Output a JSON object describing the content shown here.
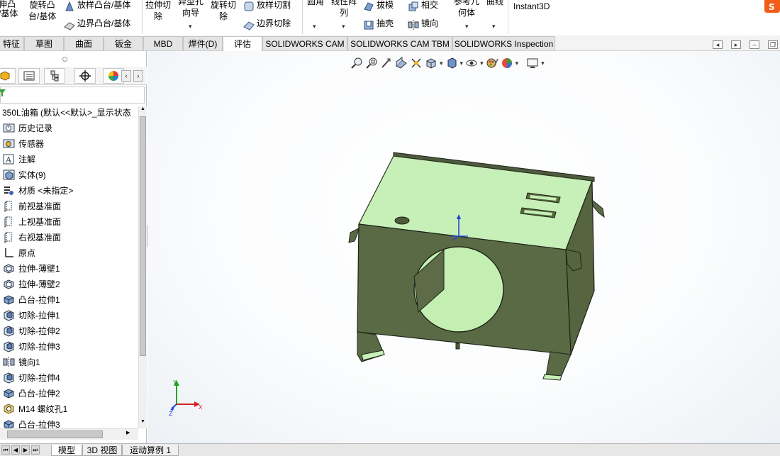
{
  "ribbon": {
    "extrude_boss": "伸凸台/基体",
    "extrude_boss_l1": "伸凸",
    "extrude_boss_l2": "/基体",
    "revolve_boss_l1": "旋转凸",
    "revolve_boss_l2": "台/基体",
    "swept_boss": "放样凸台/基体",
    "boundary_boss": "边界凸台/基体",
    "extruded_cut_l1": "拉伸切",
    "extruded_cut_l2": "除",
    "hole_wizard_l1": "异型孔",
    "hole_wizard_l2": "向导",
    "revolve_cut_l1": "旋转切",
    "revolve_cut_l2": "除",
    "lofted_cut": "放样切割",
    "boundary_cut": "边界切除",
    "fillet": "圆角",
    "linear_pattern_l1": "线性阵",
    "linear_pattern_l2": "列",
    "draft": "拔模",
    "intersect": "相交",
    "shell": "抽壳",
    "mirror": "镜向",
    "ref_geometry_l1": "参考几",
    "ref_geometry_l2": "何体",
    "curves": "曲线",
    "instant3d": "Instant3D"
  },
  "tabs": [
    "特征",
    "草图",
    "曲面",
    "钣金",
    "MBD",
    "焊件(D)",
    "评估",
    "SOLIDWORKS CAM",
    "SOLIDWORKS CAM TBM",
    "SOLIDWORKS Inspection"
  ],
  "tabs_active": "评估",
  "tree": {
    "root": "350L油箱  (默认<<默认>_显示状态",
    "items": [
      {
        "icon": "history-icon",
        "label": "历史记录"
      },
      {
        "icon": "sensor-icon",
        "label": "传感器"
      },
      {
        "icon": "annotation-icon",
        "label": "注解"
      },
      {
        "icon": "solid-bodies-icon",
        "label": "实体(9)"
      },
      {
        "icon": "material-icon",
        "label": "材质 <未指定>"
      },
      {
        "icon": "plane-icon",
        "label": "前视基准面"
      },
      {
        "icon": "plane-icon",
        "label": "上视基准面"
      },
      {
        "icon": "plane-icon",
        "label": "右视基准面"
      },
      {
        "icon": "origin-icon",
        "label": "原点"
      },
      {
        "icon": "extrude-thin-icon",
        "label": "拉伸-薄壁1"
      },
      {
        "icon": "extrude-thin-icon",
        "label": "拉伸-薄壁2"
      },
      {
        "icon": "boss-extrude-icon",
        "label": "凸台-拉伸1"
      },
      {
        "icon": "cut-extrude-icon",
        "label": "切除-拉伸1"
      },
      {
        "icon": "cut-extrude-icon",
        "label": "切除-拉伸2"
      },
      {
        "icon": "cut-extrude-icon",
        "label": "切除-拉伸3"
      },
      {
        "icon": "mirror-icon",
        "label": "镜向1"
      },
      {
        "icon": "cut-extrude-icon",
        "label": "切除-拉伸4"
      },
      {
        "icon": "boss-extrude-icon",
        "label": "凸台-拉伸2"
      },
      {
        "icon": "thread-hole-icon",
        "label": "M14 螺纹孔1"
      },
      {
        "icon": "boss-extrude-icon",
        "label": "凸台-拉伸3"
      }
    ]
  },
  "triad": {
    "x": "X",
    "y": "Y",
    "z": "Z"
  },
  "bottom_tabs": [
    "模型",
    "3D 视图",
    "运动算例 1"
  ],
  "bottom_tabs_active": "模型"
}
